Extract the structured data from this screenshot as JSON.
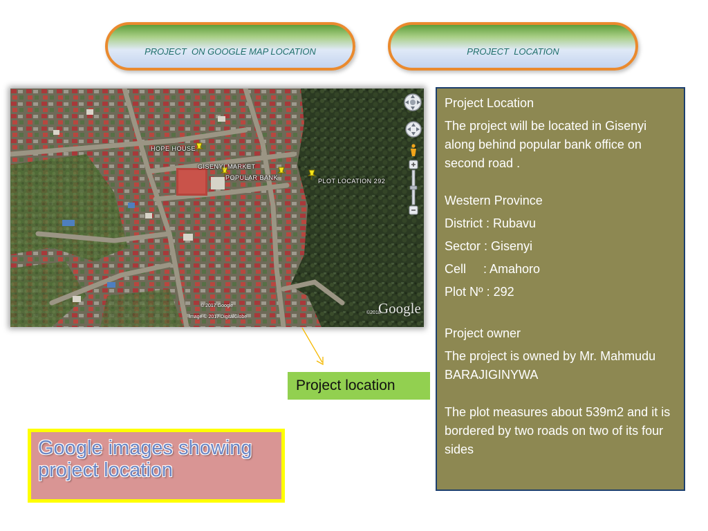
{
  "header": {
    "left_pill": "PROJECT  ON GOOGLE MAP LOCATION",
    "right_pill": "PROJECT  LOCATION"
  },
  "map": {
    "labels": {
      "hope_house": "HOPE HOUSE",
      "gisenyi_market": "GISENYI MARKET",
      "popular_bank": "POPULAR BANK",
      "plot_location": "PLOT LOCATION 292"
    },
    "copyright_google": "© 2017 Google",
    "copyright_image": "Image © 2017 DigitalGlobe",
    "copyright_year": "©2018",
    "watermark": "Google",
    "pin_color": "#f5e61a"
  },
  "info_panel": {
    "heading": "Project Location",
    "description": "The project  will be located in Gisenyi along  behind  popular bank office on second road .",
    "province": "Western Province",
    "district": "District : Rubavu",
    "sector": "Sector : Gisenyi",
    "cell": "Cell     : Amahoro",
    "plot": "Plot Nº : 292",
    "owner_heading": "Project owner",
    "owner_text": "The project is owned by Mr. Mahmudu BARAJIGINYWA",
    "plot_measure": "The plot measures about 539m2 and it is bordered by two roads  on two of its four sides"
  },
  "callout": {
    "label": "Project location"
  },
  "caption": {
    "line1": "Google images showing",
    "line2": "project location"
  },
  "colors": {
    "pill_border": "#ea8a2e",
    "info_bg": "#8d8852",
    "info_border": "#1c3f6e",
    "callout_bg": "#92d050",
    "caption_bg": "#d99594",
    "caption_border": "#ffff00",
    "caption_text": "#6b86c4",
    "arrow": "#f5b800"
  }
}
